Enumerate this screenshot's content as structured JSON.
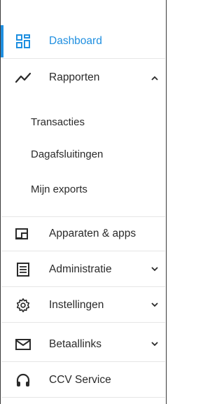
{
  "nav": {
    "dashboard": {
      "label": "Dashboard",
      "icon": "dashboard-grid-icon",
      "active": true
    },
    "rapporten": {
      "label": "Rapporten",
      "icon": "chart-line-icon",
      "expanded": true,
      "children": [
        "Transacties",
        "Dagafsluitingen",
        "Mijn exports"
      ]
    },
    "apparaten": {
      "label": "Apparaten & apps",
      "icon": "devices-icon"
    },
    "administratie": {
      "label": "Administratie",
      "icon": "document-list-icon"
    },
    "instellingen": {
      "label": "Instellingen",
      "icon": "gear-icon"
    },
    "betaallinks": {
      "label": "Betaallinks",
      "icon": "envelope-icon"
    },
    "ccv_service": {
      "label": "CCV Service",
      "icon": "headset-icon"
    }
  },
  "colors": {
    "accent": "#1f8fe0",
    "text": "#2a2a2a",
    "divider": "#e6e6e6"
  }
}
